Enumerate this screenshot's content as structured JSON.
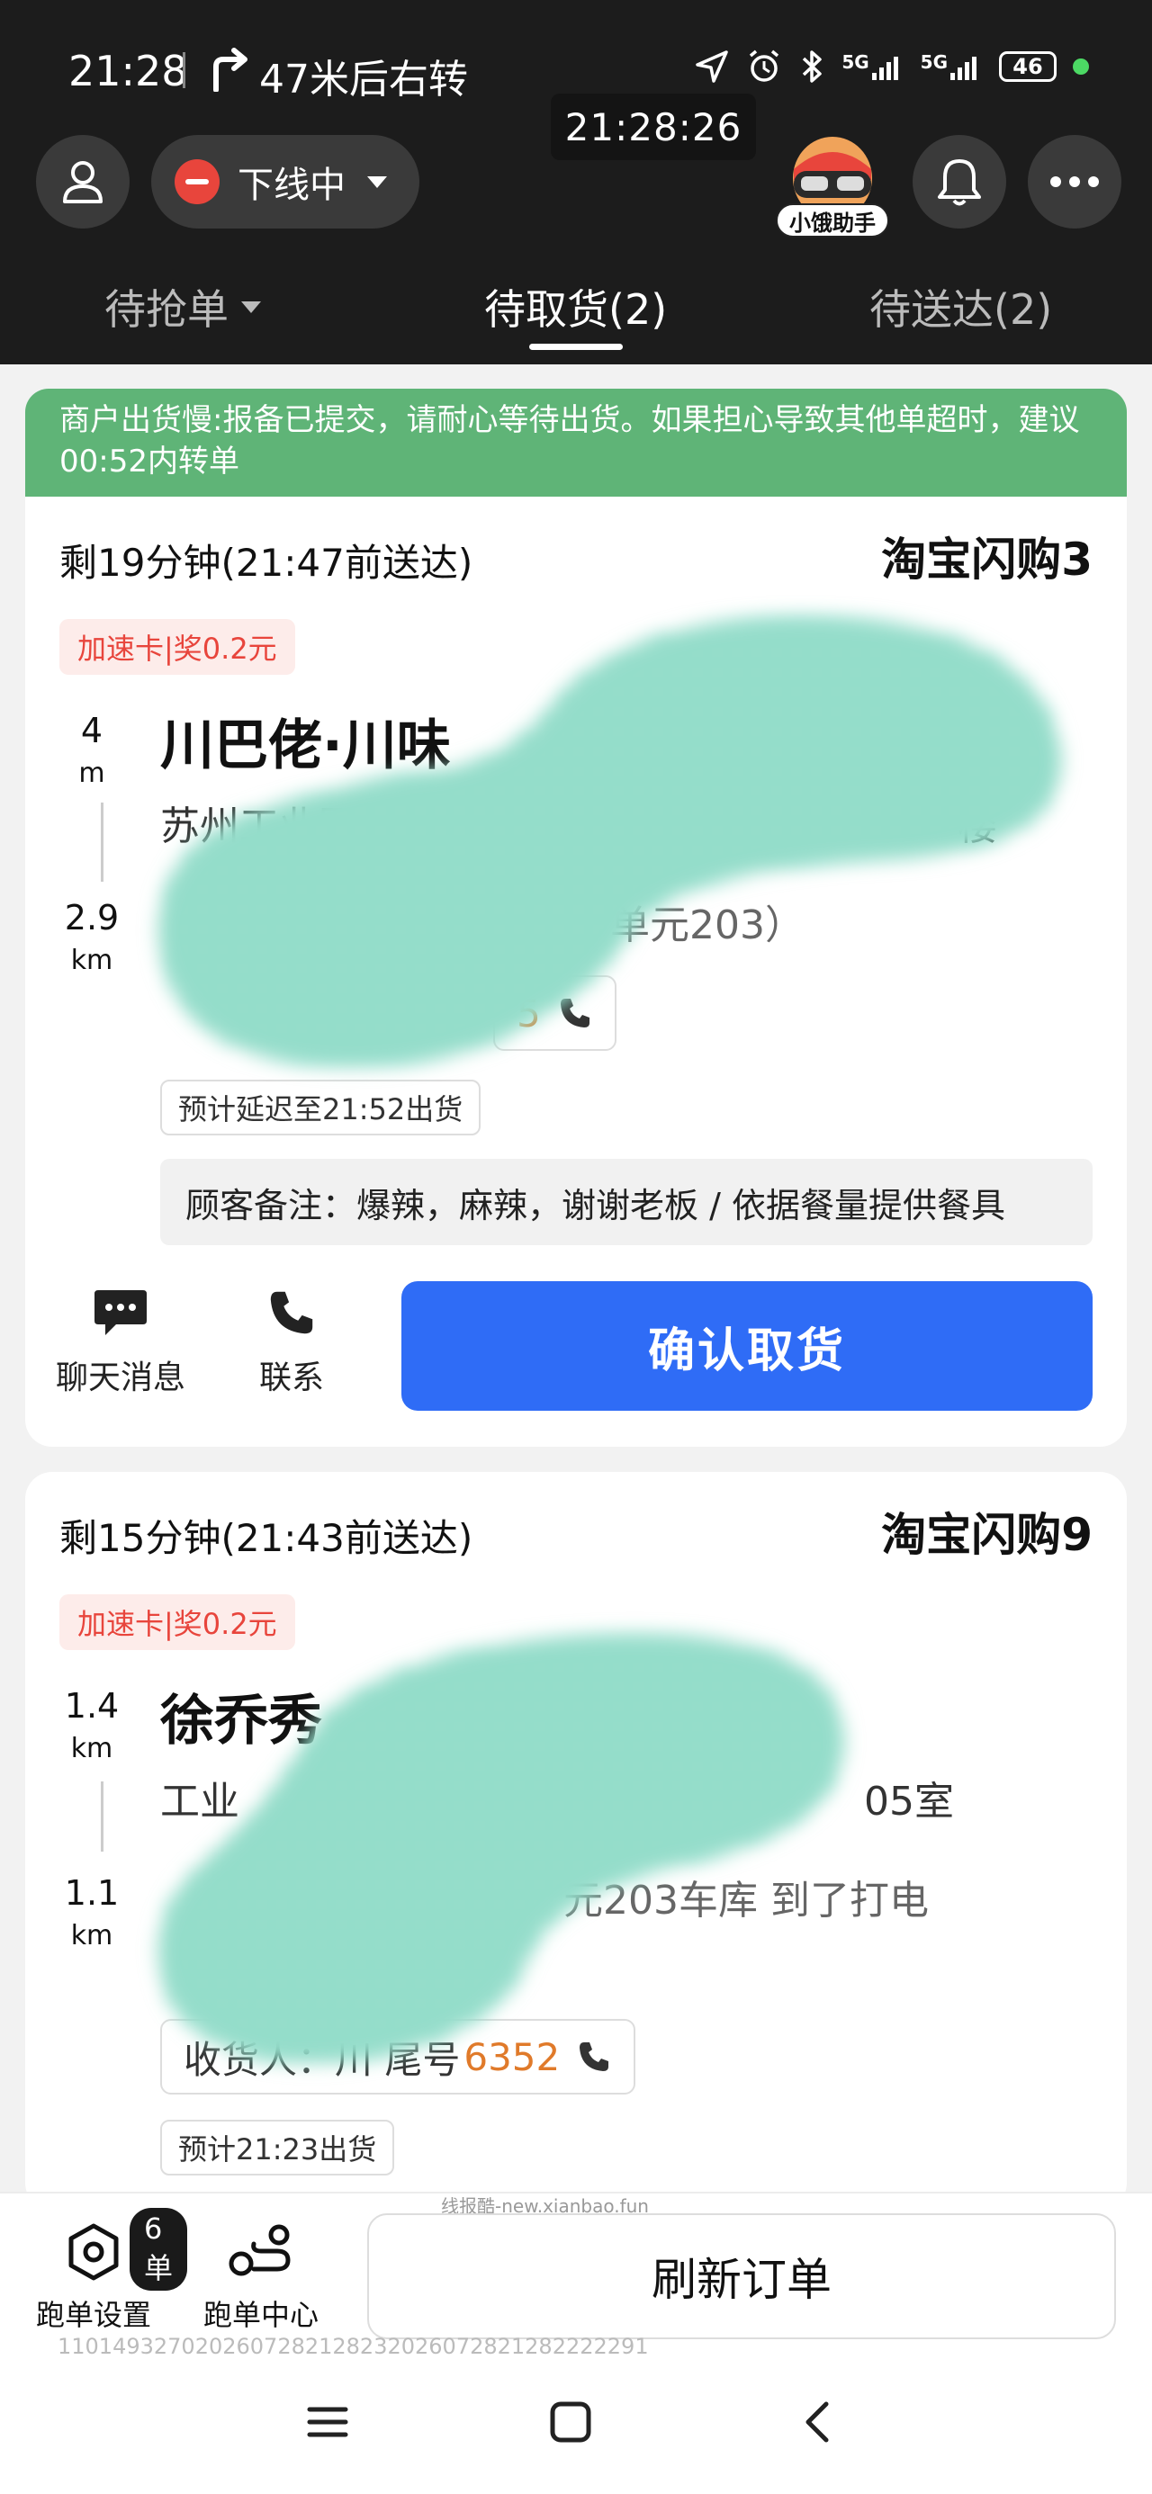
{
  "status_bar": {
    "time": "21:28",
    "navigation": "47米后右转",
    "network_1": "5G",
    "network_2": "5G",
    "battery": "46"
  },
  "header": {
    "clock": "21:28:26",
    "status_label": "下线中",
    "assistant_label": "小饿助手"
  },
  "tabs": [
    {
      "label": "待抢单"
    },
    {
      "label": "待取货(2)"
    },
    {
      "label": "待送达(2)"
    }
  ],
  "notice": "商户出货慢:报备已提交，请耐心等待出货。如果担心导致其他单超时，建议00:52内转单",
  "orders": [
    {
      "time_left": "剩19分钟(21:47前送达)",
      "shop_tag": "淘宝闪购3",
      "badge": "加速卡|奖0.2元",
      "pickup_distance": "4",
      "pickup_unit": "m",
      "delivery_distance": "2.9",
      "delivery_unit": "km",
      "shop_name": "川巴佬·川味",
      "shop_address": "苏州工业园区",
      "shop_address_tail": "楼",
      "customer_address": "单元203）",
      "phone_tail": "5",
      "eta": "预计延迟至21:52出货",
      "remark": "顾客备注：爆辣，麻辣，谢谢老板 / 依据餐量提供餐具",
      "chat_label": "聊天消息",
      "contact_label": "联系",
      "confirm_label": "确认取货"
    },
    {
      "time_left": "剩15分钟(21:43前送达)",
      "shop_tag": "淘宝闪购9",
      "badge": "加速卡|奖0.2元",
      "pickup_distance": "1.4",
      "pickup_unit": "km",
      "delivery_distance": "1.1",
      "delivery_unit": "km",
      "shop_name": "徐乔秀",
      "shop_address": "工业",
      "shop_address_tail": "05室",
      "customer_address": "元203车库 到了打电",
      "receiver_prefix": "收货人：川 尾号",
      "phone_tail": "6352",
      "eta": "预计21:23出货"
    }
  ],
  "bottom": {
    "order_count": "6单",
    "settings_label": "跑单设置",
    "center_label": "跑单中心",
    "refresh_label": "刷新订单",
    "footer_id": "1101493270202607282128232026072821282222291",
    "site_watermark": "线报酷-new.xianbao.fun"
  },
  "colors": {
    "header_bg": "#1c1c1c",
    "notice_green": "#5fb477",
    "primary_blue": "#2f6cf6",
    "badge_red": "#e8453c",
    "phone_orange": "#e07a2a",
    "mask_teal": "#7fd8c2"
  }
}
